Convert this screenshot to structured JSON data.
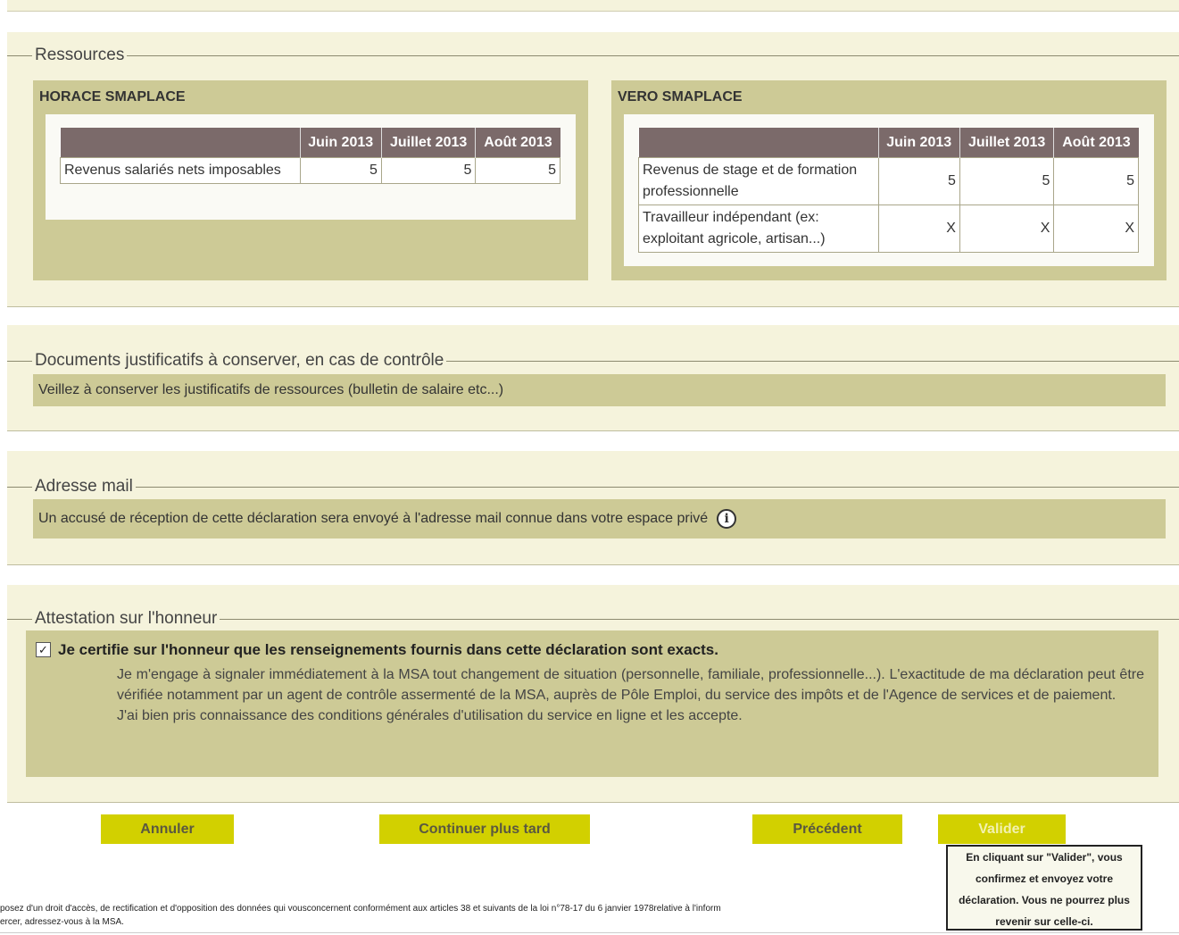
{
  "ressources": {
    "legend": "Ressources",
    "panels": [
      {
        "name": "HORACE SMAPLACE",
        "headers": [
          "",
          "Juin 2013",
          "Juillet 2013",
          "Août 2013"
        ],
        "rows": [
          {
            "label": "Revenus salariés nets imposables",
            "values": [
              "5",
              "5",
              "5"
            ]
          }
        ]
      },
      {
        "name": "VERO SMAPLACE",
        "headers": [
          "",
          "Juin 2013",
          "Juillet 2013",
          "Août 2013"
        ],
        "rows": [
          {
            "label": "Revenus de stage et de formation professionnelle",
            "values": [
              "5",
              "5",
              "5"
            ]
          },
          {
            "label": "Travailleur indépendant (ex: exploitant agricole, artisan...)",
            "values": [
              "X",
              "X",
              "X"
            ]
          }
        ]
      }
    ]
  },
  "documents": {
    "legend": "Documents justificatifs à conserver, en cas de contrôle",
    "text": "Veillez à conserver les justificatifs de ressources (bulletin de salaire etc...)"
  },
  "mail": {
    "legend": "Adresse mail",
    "text": "Un accusé de réception de cette déclaration sera envoyé à l'adresse mail connue dans votre espace privé",
    "icon": "info-icon"
  },
  "attestation": {
    "legend": "Attestation sur l'honneur",
    "checked": true,
    "title": "Je certifie sur l'honneur que les renseignements fournis dans cette déclaration sont exacts.",
    "paragraph1": "Je m'engage à signaler immédiatement à la MSA tout changement de situation (personnelle, familiale, professionnelle...). L'exactitude de ma déclaration peut être vérifiée notamment par un agent de contrôle assermenté de la MSA, auprès de Pôle Emploi, du service des impôts et de l'Agence de services et de paiement.",
    "paragraph2": "J'ai bien pris connaissance des conditions générales d'utilisation du service en ligne et les accepte."
  },
  "buttons": {
    "annuler": "Annuler",
    "continuer": "Continuer plus tard",
    "precedent": "Précédent",
    "valider": "Valider"
  },
  "tooltip": {
    "line1": "En cliquant sur \"Valider\", vous",
    "line2": "confirmez et envoyez votre",
    "line3": "déclaration. Vous ne pourrez plus",
    "line4": "revenir sur celle-ci."
  },
  "footer": {
    "line1": "posez d'un droit d'accès, de rectification et d'opposition des données qui vousconcernent conformément aux articles 38 et suivants de la loi n°78-17 du 6 janvier 1978relative à l'inform",
    "line2": "ercer, adressez-vous à la MSA."
  }
}
